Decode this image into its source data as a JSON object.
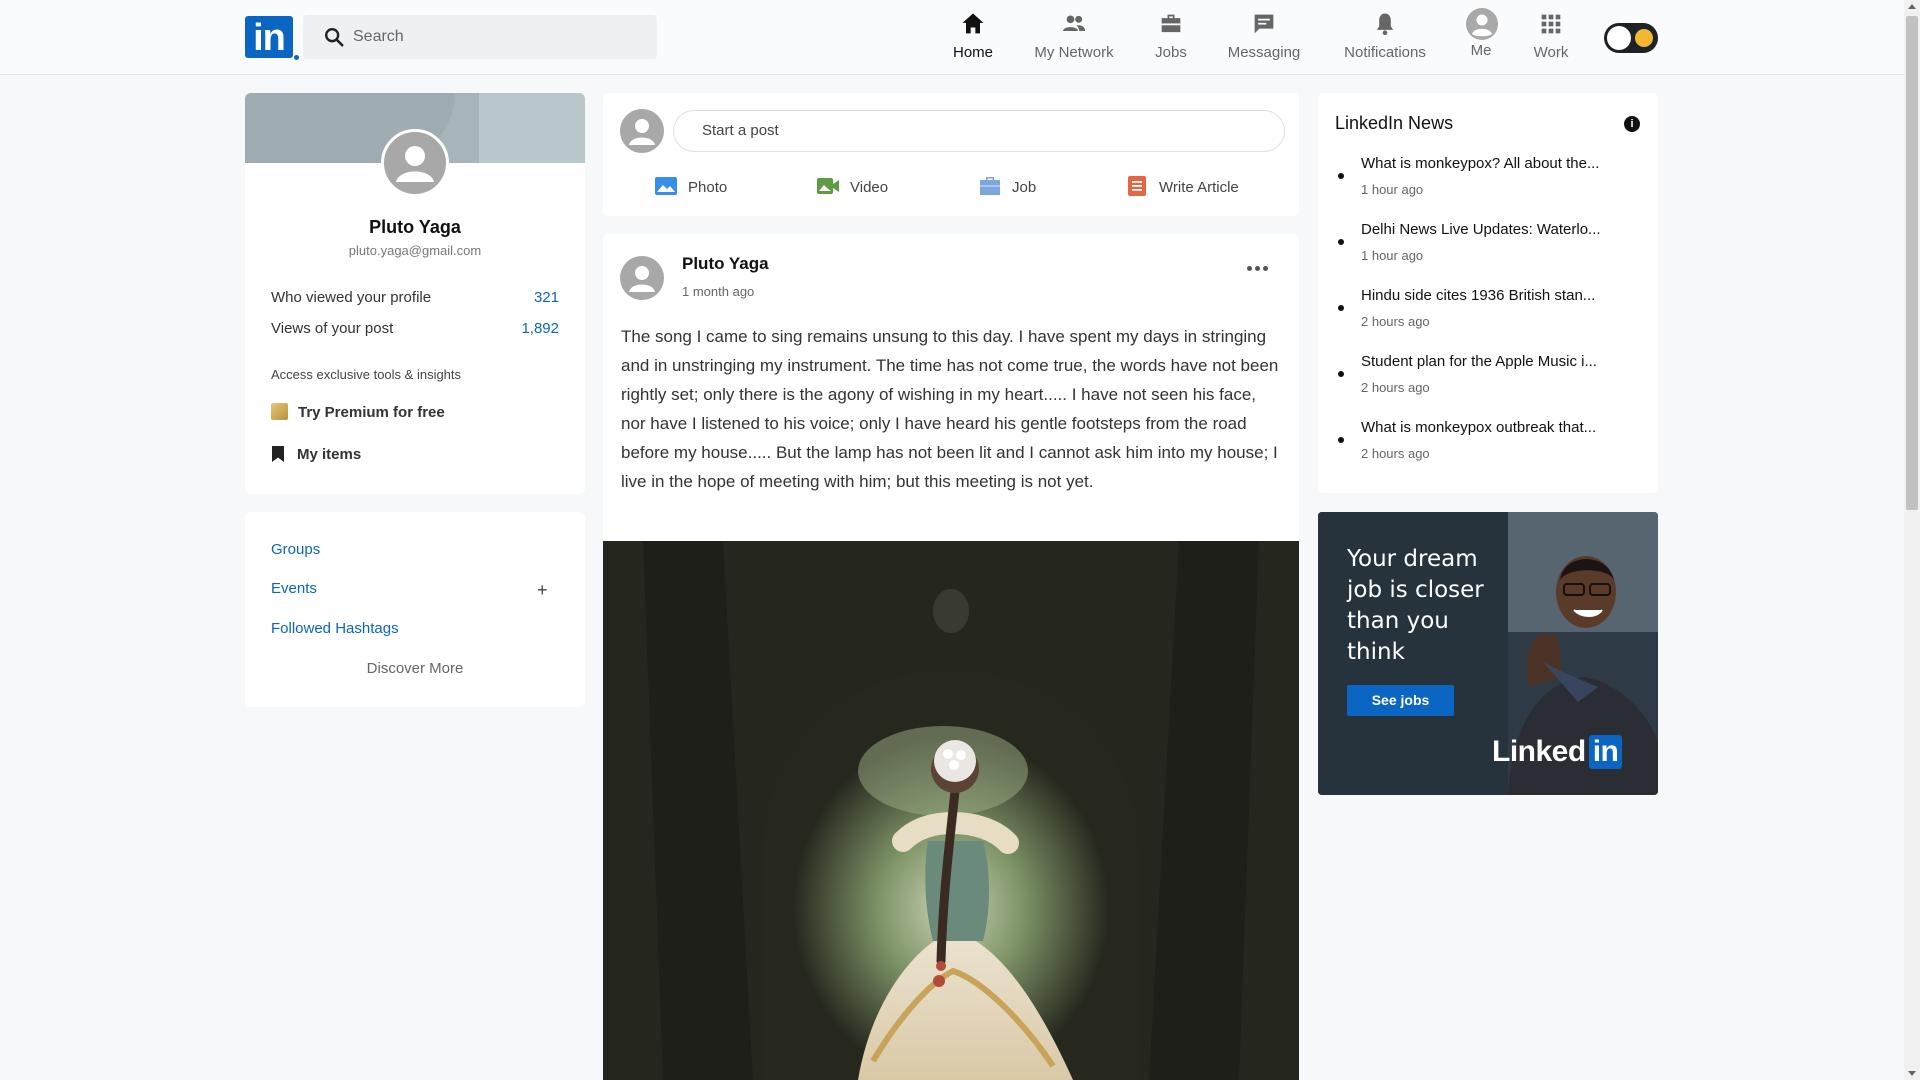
{
  "header": {
    "logo_text": "in",
    "search_placeholder": "Search",
    "nav": [
      {
        "label": "Home",
        "icon": "home-icon",
        "active": true
      },
      {
        "label": "My Network",
        "icon": "network-icon"
      },
      {
        "label": "Jobs",
        "icon": "jobs-icon"
      },
      {
        "label": "Messaging",
        "icon": "messaging-icon"
      },
      {
        "label": "Notifications",
        "icon": "bell-icon"
      },
      {
        "label": "Me",
        "icon": "avatar-icon"
      },
      {
        "label": "Work",
        "icon": "grid-icon"
      }
    ]
  },
  "profile": {
    "name": "Pluto Yaga",
    "email": "pluto.yaga@gmail.com",
    "stats": [
      {
        "label": "Who viewed your profile",
        "value": "321"
      },
      {
        "label": "Views of your post",
        "value": "1,892"
      }
    ],
    "insight_text": "Access exclusive tools & insights",
    "premium_label": "Try Premium for free",
    "my_items_label": "My items"
  },
  "links": {
    "groups": "Groups",
    "events": "Events",
    "events_add": "+",
    "hashtags": "Followed Hashtags",
    "discover": "Discover More"
  },
  "composer": {
    "placeholder": "Start a post",
    "actions": [
      {
        "label": "Photo",
        "icon": "photo-icon",
        "color": "#378fe9"
      },
      {
        "label": "Video",
        "icon": "video-icon",
        "color": "#5f9b41"
      },
      {
        "label": "Job",
        "icon": "job-icon",
        "color": "#7fc15e"
      },
      {
        "label": "Write Article",
        "icon": "article-icon",
        "color": "#e16745"
      }
    ]
  },
  "post": {
    "author": "Pluto Yaga",
    "time": "1 month ago",
    "text": "The song I came to sing remains unsung to this day. I have spent my days in stringing and in unstringing my instrument. The time has not come true, the words have not been rightly set; only there is the agony of wishing in my heart..... I have not seen his face, nor have I listened to his voice; only I have heard his gentle footsteps from the road before my house..... But the lamp has not been lit and I cannot ask him into my house; I live in the hope of meeting with him; but this meeting is not yet."
  },
  "news": {
    "title": "LinkedIn News",
    "items": [
      {
        "headline": "What is monkeypox? All about the...",
        "time": "1 hour ago"
      },
      {
        "headline": "Delhi News Live Updates: Waterlo...",
        "time": "1 hour ago"
      },
      {
        "headline": "Hindu side cites 1936 British stan...",
        "time": "2 hours ago"
      },
      {
        "headline": "Student plan for the Apple Music i...",
        "time": "2 hours ago"
      },
      {
        "headline": "What is monkeypox outbreak that...",
        "time": "2 hours ago"
      }
    ]
  },
  "ad": {
    "text": "Your dream job is closer than you think",
    "button": "See jobs",
    "brand_linked": "Linked",
    "brand_in": "in"
  }
}
